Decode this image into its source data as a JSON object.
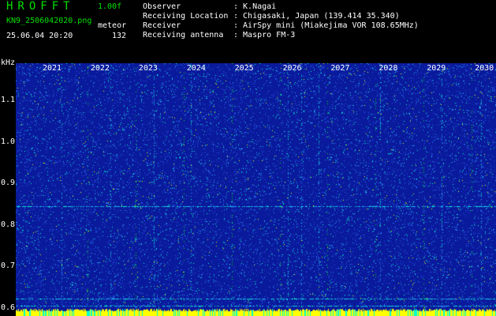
{
  "header": {
    "app_title": "HROFFT",
    "version": "1.00f",
    "filename": "KN9_2506042020.png",
    "mode": "meteor",
    "datetime": "25.06.04 20:20",
    "count": "132"
  },
  "info": {
    "rows": [
      {
        "label": "Observer",
        "value": ": K.Nagai"
      },
      {
        "label": "Receiving Location",
        "value": ": Chigasaki, Japan (139.414 35.340)"
      },
      {
        "label": "Receiver",
        "value": ": AirSpy mini (Miakejima VOR 108.65MHz)"
      },
      {
        "label": "Receiving antenna",
        "value": ": Maspro FM-3"
      }
    ]
  },
  "chart_data": {
    "type": "heatmap",
    "ylabel": "kHz",
    "y_ticks": [
      "1.1",
      "1.0",
      "0.9",
      "0.8",
      "0.7",
      "0.6"
    ],
    "y_tick_values": [
      1.1,
      1.0,
      0.9,
      0.8,
      0.7,
      0.6
    ],
    "ylim": [
      0.58,
      1.19
    ],
    "x_labels": [
      "2021",
      "2022",
      "2023",
      "2024",
      "2025",
      "2026",
      "2027",
      "2028",
      "2029",
      "2030"
    ],
    "horizontal_lines_khz": [
      0.845,
      0.622,
      0.604
    ],
    "colors": {
      "background": "#0a1a9c",
      "noise_low": "#2850e6",
      "noise_mid": "#28a0ff",
      "noise_high": "#00ffd0",
      "noise_peak": "#c8ff00",
      "bottom_band": "#ffff00",
      "grid": "#00e000"
    }
  }
}
